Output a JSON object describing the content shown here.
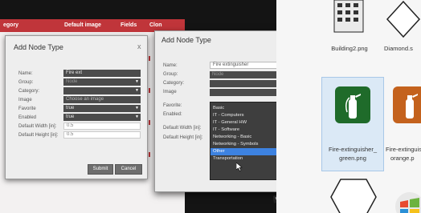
{
  "bg_table": {
    "headers": [
      "egory",
      "Default image",
      "Fields",
      "Clon"
    ]
  },
  "dialog1": {
    "title": "Add Node Type",
    "close": "x",
    "labels": [
      "Name:",
      "Group:",
      "Category:",
      "Image",
      "Favorite",
      "Enabled",
      "Default Width [in]:",
      "Default Height [in]:"
    ],
    "name_value": "Fire ext",
    "group_value": "Node",
    "category_value": "",
    "image_value": "Choose an image",
    "favorite_value": "true",
    "enabled_value": "true",
    "width_value": "0.5",
    "height_value": "0.5",
    "submit": "Submit",
    "cancel": "Cancel"
  },
  "dialog2": {
    "title": "Add Node Type",
    "close": "x",
    "labels": [
      "Name:",
      "Group:",
      "Category:",
      "Image",
      "Favorite:",
      "Enabled:",
      "Default Width [in]:",
      "Default Height [in]:"
    ],
    "name_value": "Fire extinguisher",
    "group_value": "Node",
    "category_value": "",
    "category_options": [
      "Basic",
      "IT - Computers",
      "IT - General HW",
      "IT - Software",
      "Networking - Basic",
      "Networking - Symbols",
      "Other",
      "Transportation"
    ],
    "selected_option": "Other"
  },
  "explorer": {
    "files": [
      {
        "name": "Building2.png"
      },
      {
        "name": "Diamond.s"
      },
      {
        "name_line1": "Fire-extinguisher_",
        "name_line2": "green.png"
      },
      {
        "name_line1": "Fire-extinguis",
        "name_line2": "orange.p"
      }
    ]
  },
  "colors": {
    "header_red": "#c0353a",
    "selection_blue": "#3d82e0",
    "extinguisher_green": "#1f6b2a",
    "extinguisher_orange": "#c4621d"
  }
}
